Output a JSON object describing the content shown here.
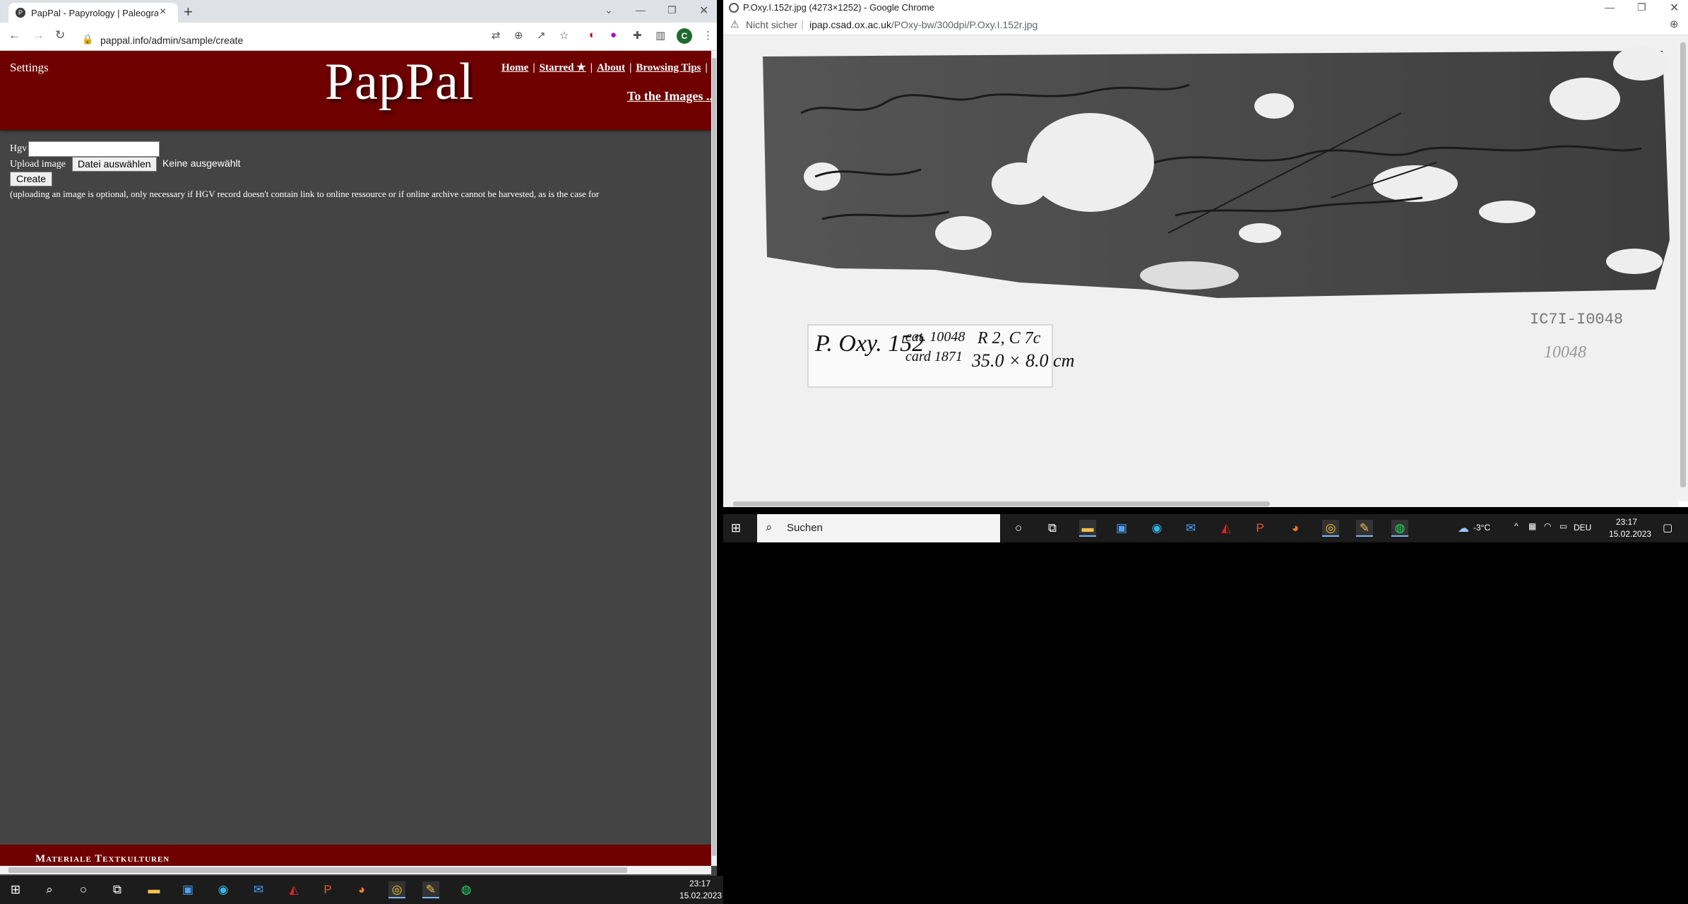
{
  "left_window": {
    "tab_title": "PapPal - Papyrology | Paleography",
    "tab_close": "×",
    "new_tab": "+",
    "url": "pappal.info/admin/sample/create"
  },
  "page": {
    "settings_label": "Settings",
    "logo": "PapPal",
    "nav": [
      "Home",
      "Starred ★",
      "About",
      "Browsing Tips"
    ],
    "nav_separator": "|",
    "to_images": "To the Images ...",
    "hgv_label": "Hgv",
    "upload_label": "Upload image",
    "file_button": "Datei auswählen",
    "no_file": "Keine ausgewählt",
    "create_button": "Create",
    "note": "(uploading an image is optional, only necessary if HGV record doesn't contain link to online ressource or if online archive cannot be harvested, as is the case for",
    "footer": "Materiale Textkulturen"
  },
  "right_window": {
    "title": "P.Oxy.I.152r.jpg (4273×1252) - Google Chrome",
    "security": "Nicht sicher",
    "url_host": "ipap.csad.ox.ac.uk",
    "url_path": "/POxy-bw/300dpi/P.Oxy.I.152r.jpg",
    "label_line1": "P. Oxy. 152",
    "label_cat": "cat. 10048",
    "label_card": "card 1871",
    "label_r2": "R 2, C 7c",
    "label_size": "35.0 × 8.0 cm",
    "inventory_tag": "IC7I-I0048",
    "pencil_number": "10048"
  },
  "taskbar_right": {
    "search_placeholder": "Suchen",
    "weather": "-3°C",
    "lang": "DEU",
    "time": "23:17",
    "date": "15.02.2023"
  },
  "taskbar_left": {
    "time": "23:17",
    "date": "15.02.2023"
  }
}
